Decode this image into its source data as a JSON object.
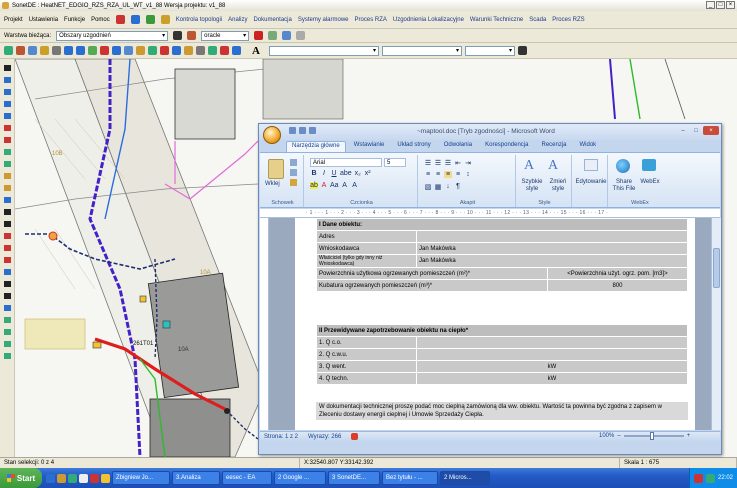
{
  "app_title": "SonetDE : HeatNET_EDGIO_RZS_RZA_UL_WT_v1_88  Wersja projektu: v1_88",
  "menu": {
    "items": [
      "Projekt",
      "Ustawienia",
      "Funkcje",
      "Pomoc"
    ],
    "links": [
      "Kontrola topologii",
      "Analizy",
      "Dokumentacja",
      "Systemy alarmowe",
      "Proces RZA",
      "Uzgodnienia Lokalizacyjne",
      "Warunki Techniczne",
      "Scada",
      "Proces RZS"
    ]
  },
  "layer": {
    "label": "Warstwa bieżąca:",
    "value": "Obszary uzgodnień",
    "db_value": "oracle"
  },
  "format_bar": {
    "font_letter": "A"
  },
  "status": {
    "selection": "Stan selekcji: 0 z 4",
    "coords": "X:32540.807  Y:33142.392",
    "scale": "Skala 1 : 675"
  },
  "map_labels": [
    "10B",
    "10A",
    "261T01",
    "10A"
  ],
  "word": {
    "title": "~maptool.doc [Tryb zgodności] - Microsoft Word",
    "tabs": [
      "Narzędzia główne",
      "Wstawianie",
      "Układ strony",
      "Odwołania",
      "Korespondencja",
      "Recenzja",
      "Widok"
    ],
    "active_tab": "Narzędzia główne",
    "font_name": "Arial",
    "font_size": "5",
    "ribbon": {
      "paste": "Wklej",
      "groups": [
        "Schowek",
        "Czcionka",
        "Akapit",
        "Style",
        "WebEx"
      ],
      "styles_btn": "Szybkie style",
      "change_styles": "Zmień style",
      "editing": "Edytowanie",
      "share": "Share This File",
      "webex": "WebEx"
    },
    "ruler_text": "· 1 · · · 1 · · · 2 · · · 3 · · · 4 · · · 5 · · · 6 · · · 7 · · · 8 · · · 9 · · · 10 · · · 11 · · · 12 · · · 13 · · · 14 · · · 15 · · · 16 · · · 17 ·",
    "doc": {
      "section1": "I Dane obiektu:",
      "rows": [
        {
          "label": "Adres",
          "value": ""
        },
        {
          "label": "Wnioskodawca",
          "value": "Jan Makówka"
        },
        {
          "label": "Właściciel (tylko gdy inny niż Wnioskodawca)",
          "value": "Jan Makówka"
        },
        {
          "label": "Powierzchnia użytkowa ogrzewanych pomieszczeń (m²)*",
          "value": "<Powierzchnia użyt. ogrz. pom. [m3]>"
        },
        {
          "label": "Kubatura ogrzewanych pomieszczeń (m³)*",
          "value": "800"
        }
      ],
      "section2": "II Przewidywane zapotrzebowanie obiektu  na ciepło*",
      "q_rows": [
        {
          "label": "1. Q c.o.",
          "value": ""
        },
        {
          "label": "2. Q c.w.u.",
          "value": ""
        },
        {
          "label": "3. Q went.",
          "value": "kW"
        },
        {
          "label": "4. Q techn.",
          "value": "kW"
        }
      ],
      "paragraph": "W dokumentacji technicznej proszę podać moc cieplną zamówioną dla ww. obiektu. Wartość ta powinna być zgodna z zapisem w Zleceniu dostawy energii cieplnej i Umowie Sprzedaży Ciepła."
    },
    "status": {
      "page": "Strona: 1 z 2",
      "words": "Wyrazy: 266",
      "zoom": "100%"
    }
  },
  "taskbar": {
    "start": "Start",
    "tasks": [
      "Zbigniew Jo...",
      "3.Analiza",
      "eesec - EA",
      "2 Google ...",
      "3 SonetDE...",
      "Bez tytułu - ...",
      "2 Micros..."
    ],
    "clock": "22:02"
  }
}
